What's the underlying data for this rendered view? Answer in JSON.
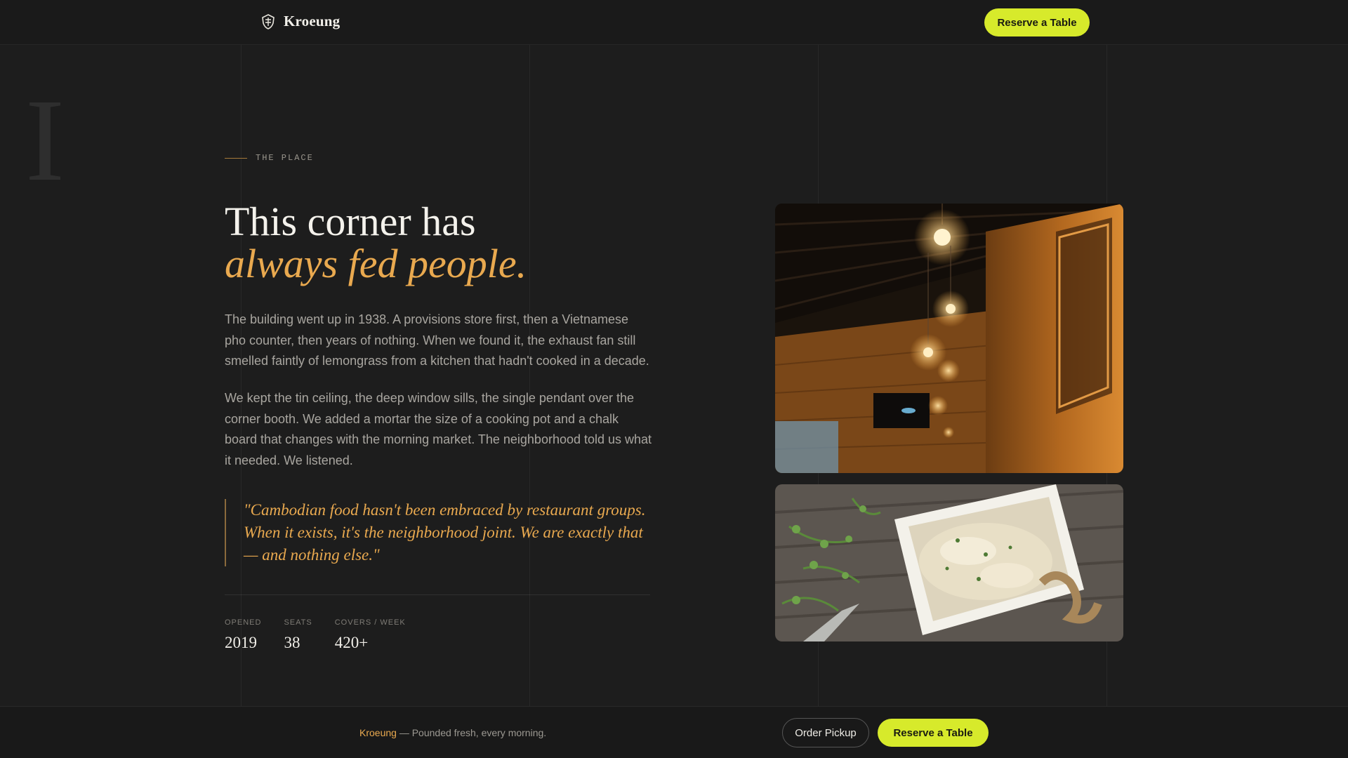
{
  "header": {
    "brand_name": "Kroeung",
    "brand_icon": "crest-icon",
    "reserve_label": "Reserve a Table"
  },
  "section": {
    "numeral": "I",
    "eyebrow": "THE PLACE",
    "heading_line1": "This corner has",
    "heading_line2": "always fed people.",
    "paragraph1": "The building went up in 1938. A provisions store first, then a Vietnamese pho counter, then years of nothing. When we found it, the exhaust fan still smelled faintly of lemongrass from a kitchen that hadn't cooked in a decade.",
    "paragraph2": "We kept the tin ceiling, the deep window sills, the single pendant over the corner booth. We added a mortar the size of a cooking pot and a chalk board that changes with the morning market. The neighborhood told us what it needed. We listened.",
    "quote": "\"Cambodian food hasn't been embraced by restaurant groups. When it exists, it's the neighborhood joint. We are exactly that — and nothing else.\"",
    "stats": [
      {
        "label": "OPENED",
        "value": "2019"
      },
      {
        "label": "SEATS",
        "value": "38"
      },
      {
        "label": "COVERS / WEEK",
        "value": "420+"
      }
    ]
  },
  "images": {
    "interior": "restaurant-interior-photo",
    "food": "dip-with-herbs-photo"
  },
  "footer": {
    "brand": "Kroeung",
    "tagline": " — Pounded fresh, every morning.",
    "order_label": "Order Pickup",
    "reserve_label": "Reserve a Table"
  },
  "colors": {
    "background": "#1d1d1d",
    "accent": "#e9a94f",
    "button": "#d7ea2b"
  }
}
